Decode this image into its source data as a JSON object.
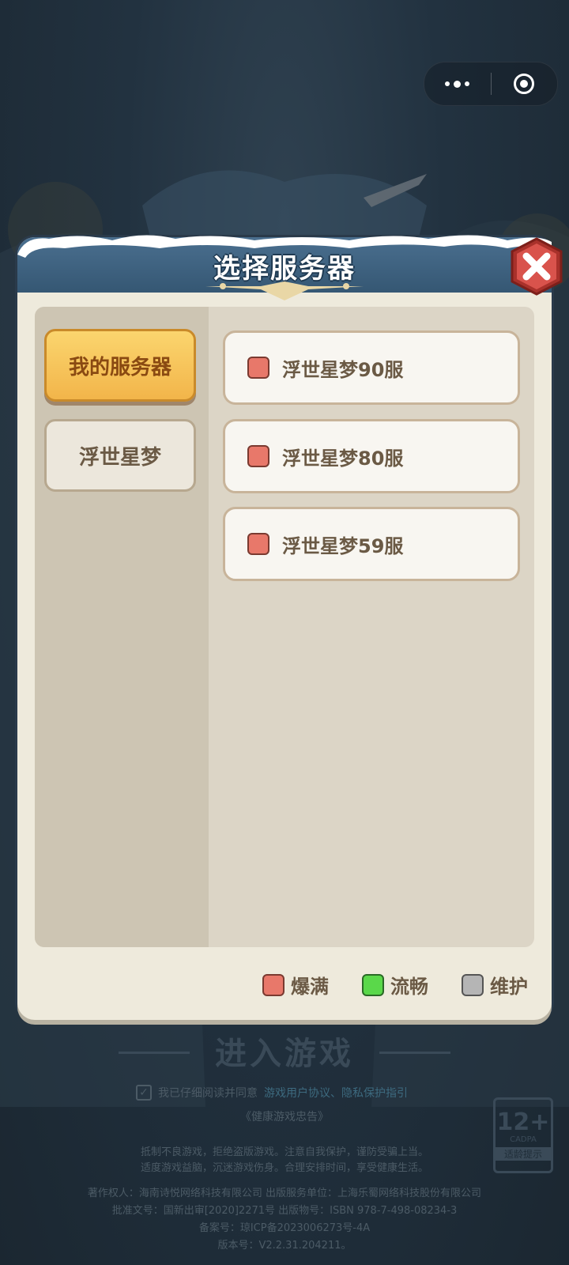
{
  "modal": {
    "title": "选择服务器"
  },
  "categories": [
    {
      "label": "我的服务器",
      "active": true
    },
    {
      "label": "浮世星梦",
      "active": false
    }
  ],
  "servers": [
    {
      "name": "浮世星梦90服",
      "status": "爆满"
    },
    {
      "name": "浮世星梦80服",
      "status": "爆满"
    },
    {
      "name": "浮世星梦59服",
      "status": "爆满"
    }
  ],
  "legend": [
    {
      "label": "爆满",
      "color": "#e8786a"
    },
    {
      "label": "流畅",
      "color": "#5ad84a"
    },
    {
      "label": "维护",
      "color": "#b5b5b5"
    }
  ],
  "bottom": {
    "enter_label": "进入游戏",
    "agree_text": "我已仔细阅读并同意",
    "agree_link": "游戏用户协议、隐私保护指引",
    "health_advice": "《健康游戏忠告》",
    "notice_1": "抵制不良游戏，拒绝盗版游戏。注意自我保护，谨防受骗上当。",
    "notice_2": "适度游戏益脑，沉迷游戏伤身。合理安排时间，享受健康生活。",
    "copyright": "著作权人：海南诗悦网络科技有限公司 出版服务单位：上海乐蜀网络科技股份有限公司",
    "approval": "批准文号：国新出审[2020]2271号 出版物号：ISBN 978-7-498-08234-3",
    "icp": "备案号：琼ICP备2023006273号-4A",
    "version": "版本号：V2.2.31.204211。",
    "age_rating": "12+",
    "age_org": "CADPA",
    "age_tip": "适龄提示"
  },
  "capsule": {
    "menu_icon": "more-dots-icon",
    "close_icon": "target-icon"
  },
  "close_button_icon": "close-x-icon"
}
